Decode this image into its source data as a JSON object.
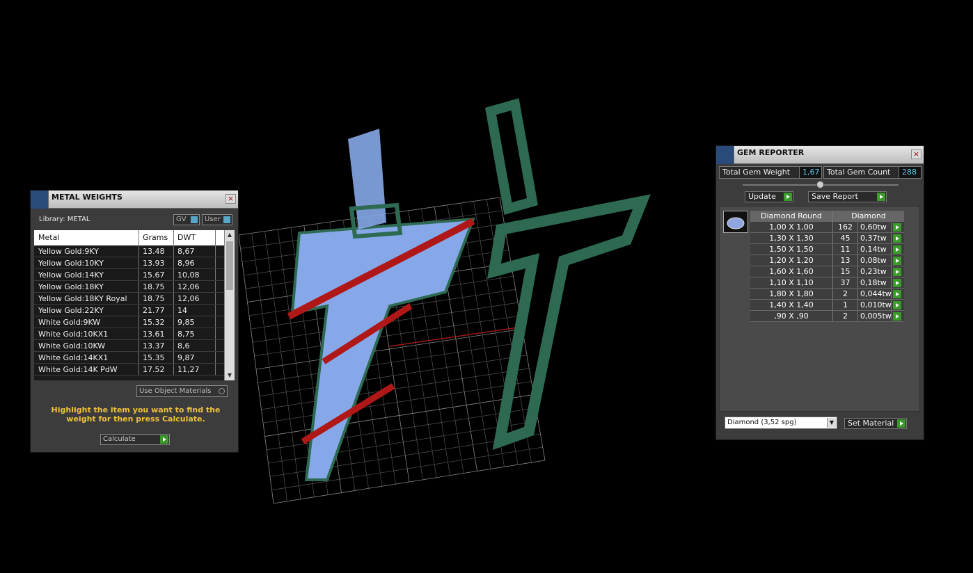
{
  "metal_weights": {
    "title": "METAL WEIGHTS",
    "close": "×",
    "library_label": "Library: METAL",
    "toggle_gv": "GV",
    "toggle_user": "User",
    "columns": [
      "Metal",
      "Grams",
      "DWT"
    ],
    "rows": [
      {
        "metal": "Yellow Gold:9KY",
        "grams": "13.48",
        "dwt": "8,67"
      },
      {
        "metal": "Yellow Gold:10KY",
        "grams": "13.93",
        "dwt": "8,96"
      },
      {
        "metal": "Yellow Gold:14KY",
        "grams": "15.67",
        "dwt": "10,08"
      },
      {
        "metal": "Yellow Gold:18KY",
        "grams": "18.75",
        "dwt": "12,06"
      },
      {
        "metal": "Yellow Gold:18KY Royal",
        "grams": "18.75",
        "dwt": "12,06"
      },
      {
        "metal": "Yellow Gold:22KY",
        "grams": "21.77",
        "dwt": "14"
      },
      {
        "metal": "White Gold:9KW",
        "grams": "15.32",
        "dwt": "9,85"
      },
      {
        "metal": "White Gold:10KX1",
        "grams": "13.61",
        "dwt": "8,75"
      },
      {
        "metal": "White Gold:10KW",
        "grams": "13.37",
        "dwt": "8,6"
      },
      {
        "metal": "White Gold:14KX1",
        "grams": "15.35",
        "dwt": "9,87"
      },
      {
        "metal": "White Gold:14K PdW",
        "grams": "17.52",
        "dwt": "11,27"
      }
    ],
    "use_object_materials": "Use Object Materials",
    "hint": "Highlight the item you want to find the weight for then press Calculate.",
    "calculate": "Calculate"
  },
  "gem_reporter": {
    "title": "GEM REPORTER",
    "close": "×",
    "total_gem_weight_label": "Total Gem Weight",
    "total_gem_weight": "1,67",
    "total_gem_count_label": "Total Gem Count",
    "total_gem_count": "288",
    "update": "Update",
    "save_report": "Save Report",
    "header_shape": "Diamond Round",
    "header_material": "Diamond",
    "rows": [
      {
        "size": "1,00 X 1,00",
        "count": "162",
        "weight": "0,60tw"
      },
      {
        "size": "1,30 X 1,30",
        "count": "45",
        "weight": "0,37tw"
      },
      {
        "size": "1,50 X 1,50",
        "count": "11",
        "weight": "0,14tw"
      },
      {
        "size": "1,20 X 1,20",
        "count": "13",
        "weight": "0,08tw"
      },
      {
        "size": "1,60 X 1,60",
        "count": "15",
        "weight": "0,23tw"
      },
      {
        "size": "1,10 X 1,10",
        "count": "37",
        "weight": "0,18tw"
      },
      {
        "size": "1,80 X 1,80",
        "count": "2",
        "weight": "0,044tw"
      },
      {
        "size": "1,40 X 1,40",
        "count": "1",
        "weight": "0,010tw"
      },
      {
        "size": ",90 X ,90",
        "count": "2",
        "weight": "0,005tw"
      }
    ],
    "material_select": "Diamond    (3,52 spg)",
    "set_material": "Set Material"
  }
}
